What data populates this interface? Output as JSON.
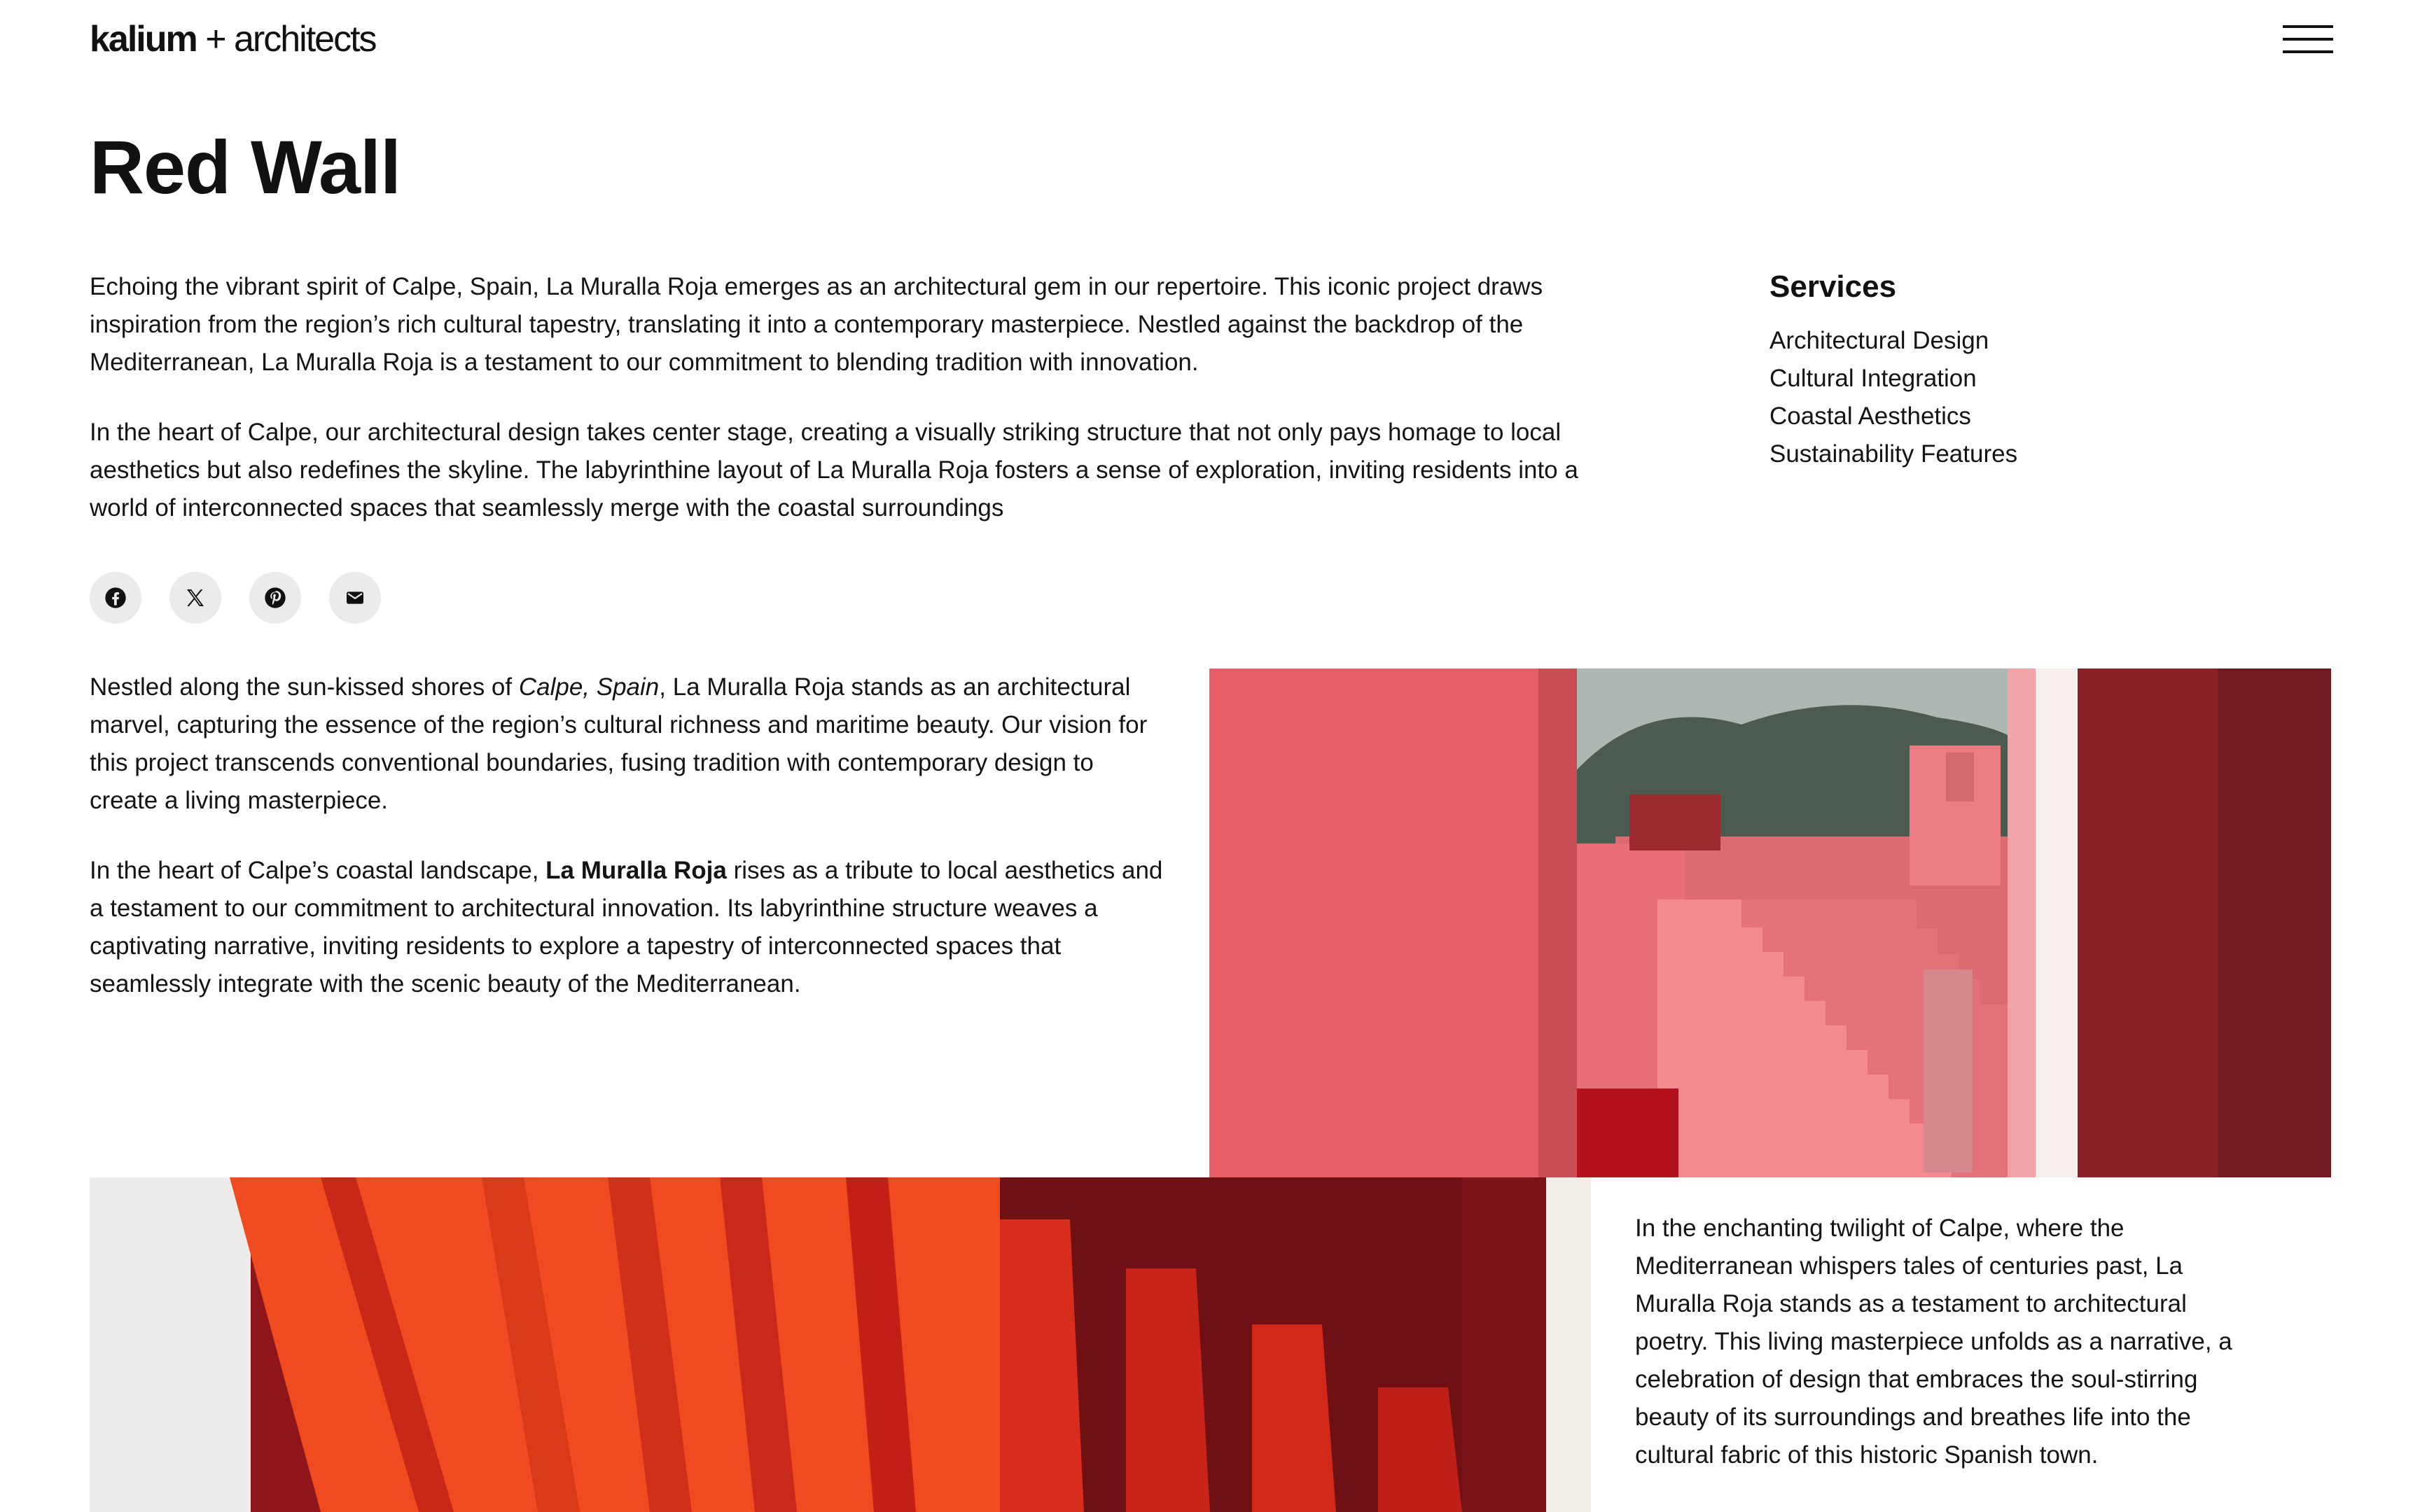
{
  "header": {
    "logo": {
      "brand": "kalium",
      "separator": "+",
      "suffix": "architects"
    },
    "menu_icon": "hamburger-menu-icon"
  },
  "project": {
    "title": "Red Wall",
    "intro": [
      "Echoing the vibrant spirit of Calpe, Spain, La Muralla Roja emerges as an architectural gem in our repertoire. This iconic project draws inspiration from the region’s rich cultural tapestry, translating it into a contemporary masterpiece. Nestled against the backdrop of the Mediterranean, La Muralla Roja is a testament to our commitment to blending tradition with innovation.",
      "In the heart of Calpe, our architectural design takes center stage, creating a visually striking structure that not only pays homage to local aesthetics but also redefines the skyline. The labyrinthine layout of La Muralla Roja fosters a sense of exploration, inviting residents into a world of interconnected spaces that seamlessly merge with the coastal surroundings"
    ],
    "body1": {
      "before": "Nestled along the sun-kissed shores of ",
      "emphasis": "Calpe, Spain",
      "after": ", La Muralla Roja stands as an architectural marvel, capturing the essence of the region’s cultural richness and maritime beauty. Our vision for this project transcends conventional boundaries, fusing tradition with contemporary design to create a living masterpiece."
    },
    "body2": {
      "before": "In the heart of Calpe’s coastal landscape, ",
      "strong": "La Muralla Roja",
      "after": " rises as a tribute to local aesthetics and a testament to our commitment to architectural innovation. Its labyrinthine structure weaves a captivating narrative, inviting residents to explore a tapestry of interconnected spaces that seamlessly integrate with the scenic beauty of the Mediterranean."
    },
    "caption": "In the enchanting twilight of Calpe, where the Mediterranean whispers tales of centuries past, La Muralla Roja stands as a testament to architectural poetry. This living masterpiece unfolds as a narrative, a celebration of design that embraces the soul-stirring beauty of its surroundings and breathes life into the cultural fabric of this historic Spanish town."
  },
  "services": {
    "heading": "Services",
    "items": [
      "Architectural Design",
      "Cultural Integration",
      "Coastal Aesthetics",
      "Sustainability Features"
    ]
  },
  "share": {
    "icons": [
      "facebook-icon",
      "x-twitter-icon",
      "pinterest-icon",
      "email-icon"
    ]
  },
  "colors": {
    "text": "#111111",
    "share_button_bg": "#ebebeb",
    "wall_pink": "#e4646a",
    "wall_dark_red": "#7c1c21",
    "wall_orange": "#f04a20"
  }
}
